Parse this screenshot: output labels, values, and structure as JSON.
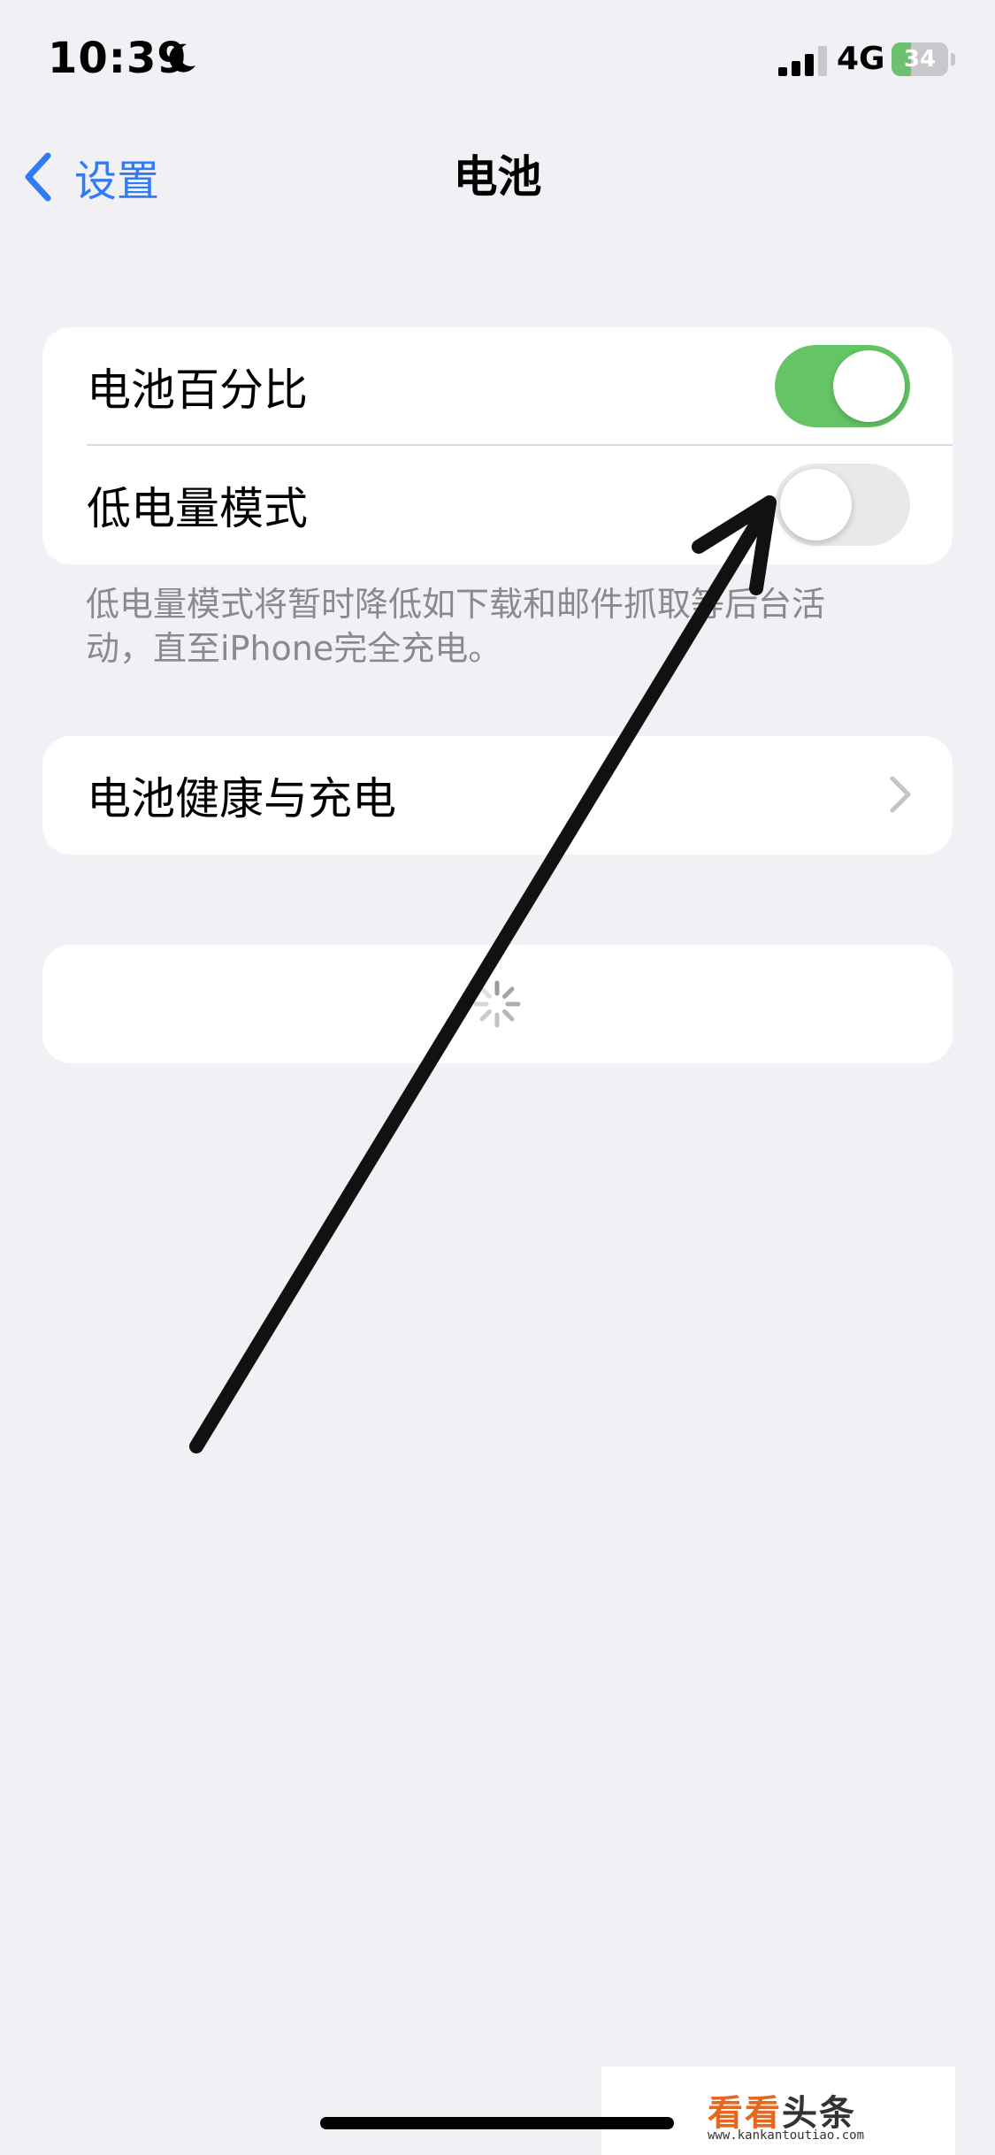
{
  "status_bar": {
    "time": "10:39",
    "network": "4G",
    "battery_percent": "34",
    "battery_level": 0.34,
    "battery_color": "#6cc070",
    "icons": [
      "moon-icon",
      "signal-icon",
      "battery-charging-icon"
    ]
  },
  "nav": {
    "back_label": "设置",
    "title": "电池"
  },
  "settings": {
    "battery_percentage_label": "电池百分比",
    "battery_percentage_on": true,
    "low_power_label": "低电量模式",
    "low_power_on": false,
    "low_power_footer": "低电量模式将暂时降低如下载和邮件抓取等后台活动，直至iPhone完全充电。",
    "health_label": "电池健康与充电"
  },
  "watermark": {
    "title_a": "看看",
    "title_b": "头条",
    "url": "www.kankantoutiao.com"
  },
  "colors": {
    "accent": "#2f7cf6",
    "toggle_on": "#65c466",
    "background": "#f0f0f5"
  }
}
